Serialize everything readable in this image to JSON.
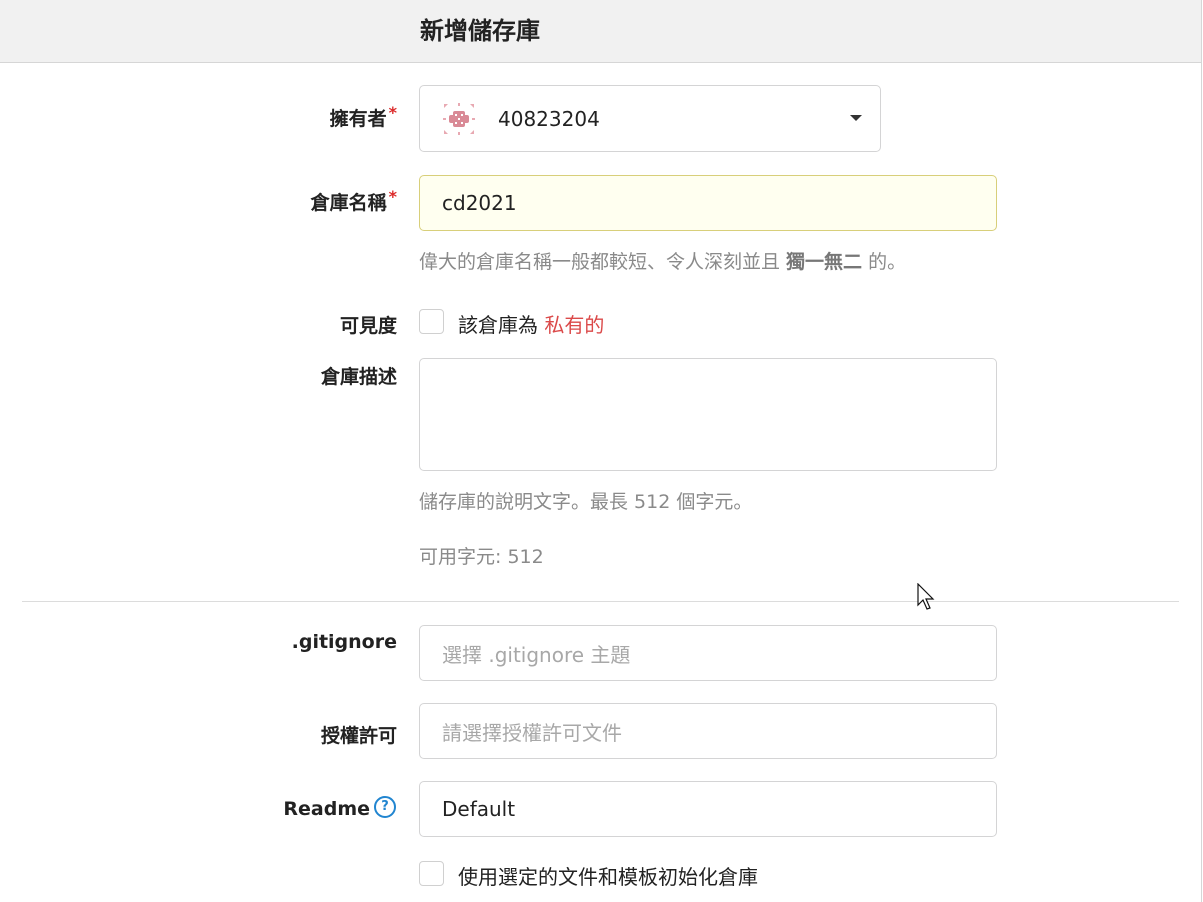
{
  "header": {
    "title": "新增儲存庫"
  },
  "form": {
    "owner": {
      "label": "擁有者",
      "required_mark": "*",
      "value": "40823204"
    },
    "repo_name": {
      "label": "倉庫名稱",
      "required_mark": "*",
      "value": "cd2021",
      "help_prefix": "偉大的倉庫名稱一般都較短、令人深刻並且 ",
      "help_bold": "獨一無二",
      "help_suffix": " 的。"
    },
    "visibility": {
      "label": "可見度",
      "checkbox_text": "該倉庫為 ",
      "checkbox_emph": "私有的"
    },
    "description": {
      "label": "倉庫描述",
      "value": "",
      "help": "儲存庫的說明文字。最長 512 個字元。",
      "remaining": "可用字元: 512"
    },
    "gitignore": {
      "label": ".gitignore",
      "placeholder": "選擇 .gitignore 主題"
    },
    "license": {
      "label": "授權許可",
      "placeholder": "請選擇授權許可文件"
    },
    "readme": {
      "label": "Readme",
      "help_icon": "?",
      "value": "Default"
    },
    "auto_init": {
      "checkbox_text": "使用選定的文件和模板初始化倉庫"
    }
  },
  "colors": {
    "required": "#db2828",
    "private_text": "#db4a4a",
    "help_icon": "#2185d0",
    "name_input_bg": "#fffff0"
  },
  "icons": {
    "avatar": "identicon-avatar",
    "owner_dropdown": "caret-down-icon",
    "readme_help": "question-circle-icon",
    "cursor": "mouse-pointer"
  }
}
